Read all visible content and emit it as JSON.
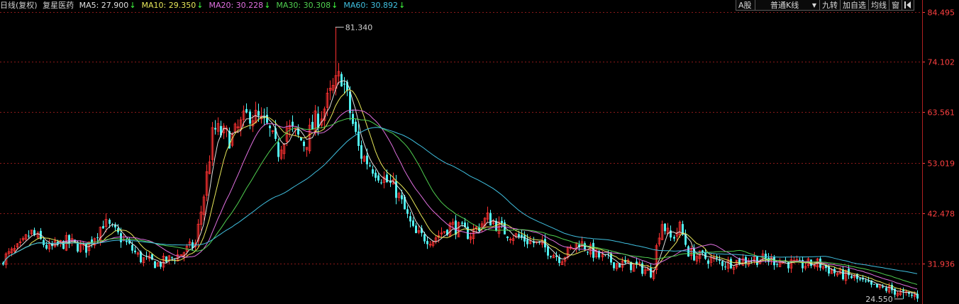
{
  "header": {
    "period": "日线(复权)",
    "stock_name": "复星医药",
    "ma": [
      {
        "label": "MA5: 27.900",
        "arrow": "↓",
        "color": "#e0e0e0"
      },
      {
        "label": "MA10: 29.350",
        "arrow": "↓",
        "color": "#e8e85a"
      },
      {
        "label": "MA20: 30.228",
        "arrow": "↓",
        "color": "#e070e0"
      },
      {
        "label": "MA30: 30.308",
        "arrow": "↓",
        "color": "#50d050"
      },
      {
        "label": "MA60: 30.892",
        "arrow": "↓",
        "color": "#40c0e0"
      }
    ]
  },
  "toolbar": {
    "a_share": "A股",
    "kline_type": "普通K线",
    "kline_caret": "▼",
    "jiuzhuan": "九转",
    "add_watch": "加自选",
    "junxian": "均线",
    "window": "窗",
    "collapse_icon": "collapse-icon"
  },
  "colors": {
    "up": "#ff3232",
    "down": "#54ffff",
    "grid": "#8b1a1a",
    "axis_text": "#ff4040",
    "ma5": "#e0e0e0",
    "ma10": "#e8e85a",
    "ma20": "#e070e0",
    "ma30": "#50d050",
    "ma60": "#40c0e0"
  },
  "chart_data": {
    "type": "candlestick",
    "ylim": [
      24.55,
      84.495
    ],
    "y_ticks": [
      "84.495",
      "74.102",
      "63.561",
      "53.019",
      "42.478",
      "31.936"
    ],
    "y_tick_values": [
      84.495,
      74.102,
      63.561,
      53.019,
      42.478,
      31.936
    ],
    "grid": true,
    "high_marker": {
      "label": "81.340",
      "value": 81.34,
      "index": 0.365
    },
    "low_marker": {
      "label": "24.550",
      "value": 24.55,
      "index": 0.985
    },
    "close_path": [
      [
        0.0,
        33.0
      ],
      [
        0.02,
        35.5
      ],
      [
        0.03,
        38.5
      ],
      [
        0.05,
        35.0
      ],
      [
        0.07,
        36.5
      ],
      [
        0.09,
        35.0
      ],
      [
        0.11,
        40.5
      ],
      [
        0.13,
        37.0
      ],
      [
        0.15,
        33.0
      ],
      [
        0.17,
        31.8
      ],
      [
        0.19,
        33.5
      ],
      [
        0.21,
        36.0
      ],
      [
        0.22,
        47.0
      ],
      [
        0.23,
        60.0
      ],
      [
        0.25,
        58.0
      ],
      [
        0.27,
        63.5
      ],
      [
        0.29,
        60.0
      ],
      [
        0.3,
        55.0
      ],
      [
        0.31,
        60.5
      ],
      [
        0.33,
        57.0
      ],
      [
        0.34,
        61.0
      ],
      [
        0.35,
        64.0
      ],
      [
        0.36,
        68.0
      ],
      [
        0.37,
        71.5
      ],
      [
        0.38,
        63.0
      ],
      [
        0.39,
        55.0
      ],
      [
        0.41,
        51.0
      ],
      [
        0.43,
        47.0
      ],
      [
        0.45,
        38.0
      ],
      [
        0.47,
        37.0
      ],
      [
        0.49,
        40.0
      ],
      [
        0.51,
        38.0
      ],
      [
        0.53,
        41.5
      ],
      [
        0.55,
        38.5
      ],
      [
        0.57,
        37.0
      ],
      [
        0.59,
        35.5
      ],
      [
        0.61,
        33.0
      ],
      [
        0.63,
        36.5
      ],
      [
        0.65,
        33.5
      ],
      [
        0.67,
        32.0
      ],
      [
        0.69,
        31.5
      ],
      [
        0.71,
        30.0
      ],
      [
        0.72,
        41.0
      ],
      [
        0.73,
        37.0
      ],
      [
        0.74,
        39.5
      ],
      [
        0.75,
        34.0
      ],
      [
        0.77,
        33.0
      ],
      [
        0.79,
        32.0
      ],
      [
        0.82,
        33.0
      ],
      [
        0.85,
        32.5
      ],
      [
        0.87,
        31.5
      ],
      [
        0.89,
        32.0
      ],
      [
        0.91,
        30.0
      ],
      [
        0.93,
        29.0
      ],
      [
        0.95,
        27.0
      ],
      [
        0.97,
        26.5
      ],
      [
        0.99,
        25.2
      ]
    ],
    "ma_windows": [
      5,
      10,
      20,
      30,
      60
    ],
    "ma_values_last": [
      27.9,
      29.35,
      30.228,
      30.308,
      30.892
    ]
  }
}
